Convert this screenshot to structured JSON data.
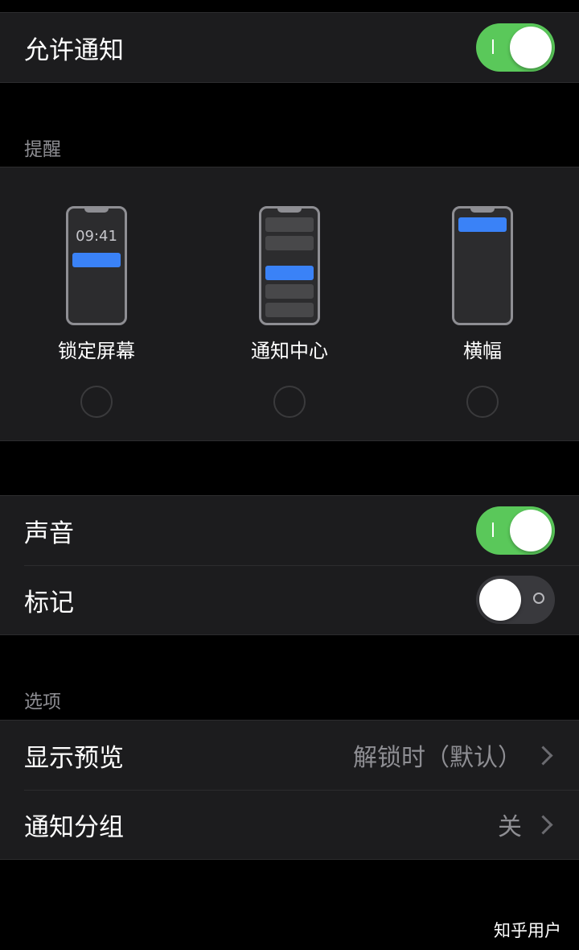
{
  "allow_notifications": {
    "label": "允许通知",
    "enabled": true
  },
  "alerts": {
    "header": "提醒",
    "options": [
      {
        "label": "锁定屏幕",
        "selected": false,
        "preview_time": "09:41"
      },
      {
        "label": "通知中心",
        "selected": false
      },
      {
        "label": "横幅",
        "selected": false
      }
    ]
  },
  "sounds_badges": {
    "sound": {
      "label": "声音",
      "enabled": true
    },
    "badge": {
      "label": "标记",
      "enabled": false
    }
  },
  "options": {
    "header": "选项",
    "show_previews": {
      "label": "显示预览",
      "value": "解锁时（默认）"
    },
    "notification_grouping": {
      "label": "通知分组",
      "value": "关"
    }
  },
  "watermark": "知乎用户",
  "colors": {
    "toggle_on": "#5ac85a",
    "toggle_off": "#39393d",
    "accent_blue": "#3a82f7",
    "group_bg": "#1c1c1e"
  }
}
